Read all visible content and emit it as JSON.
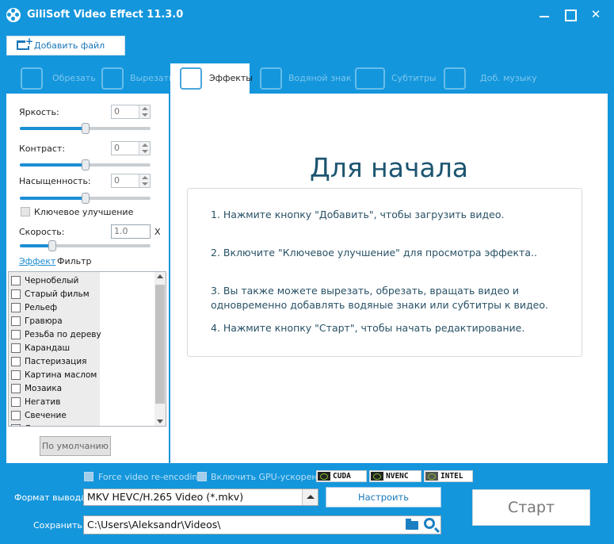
{
  "app": {
    "title": "GiliSoft Video Effect 11.3.0"
  },
  "toolbar": {
    "add_file_label": "Добавить файл"
  },
  "tabs": [
    {
      "label": "Обрезать",
      "icon": "crop-icon"
    },
    {
      "label": "Вырезать",
      "icon": "film-cut-icon"
    },
    {
      "label": "Эффекты",
      "icon": "magic-wand-icon",
      "active": true
    },
    {
      "label": "Водяной знак",
      "icon": "watermark-icon"
    },
    {
      "label": "Субтитры",
      "icon": "subtitle-icon"
    },
    {
      "label": "Доб. музыку",
      "icon": "music-note-icon"
    }
  ],
  "adjustments": {
    "brightness": {
      "label": "Яркость:",
      "value": "0",
      "level": 0.5
    },
    "contrast": {
      "label": "Контраст:",
      "value": "0",
      "level": 0.5
    },
    "saturation": {
      "label": "Насыщенность:",
      "value": "0",
      "level": 0.5
    },
    "key_enhance": {
      "label": "Ключевое улучшение",
      "checked": false
    },
    "speed": {
      "label": "Скорость:",
      "value": "1.0",
      "suffix": "X",
      "level": 0.25
    }
  },
  "effect_tabs": {
    "effect": "Эффект",
    "filter": "Фильтр"
  },
  "effects": [
    "Чернобелый",
    "Старый фильм",
    "Рельеф",
    "Гравюра",
    "Резьба по дереву",
    "Карандаш",
    "Пастеризация",
    "Картина маслом",
    "Мозаика",
    "Негатив",
    "Свечение",
    "Дымка"
  ],
  "reset_label": "По умолчанию",
  "main": {
    "heading": "Для начала",
    "instructions": [
      "1. Нажмите кнопку \"Добавить\", чтобы загрузить видео.",
      "2. Включите \"Ключевое улучшение\" для просмотра эффекта..",
      "3. Вы также можете вырезать, обрезать, вращать видео и одновременно добавлять водяные знаки или субтитры к видео.",
      "4. Нажмите кнопку \"Старт\", чтобы начать редактирование."
    ]
  },
  "bottom": {
    "force_reencode": "Force video re-encoding",
    "gpu_accel": "Включить GPU-ускорение",
    "gpu_badges": [
      "CUDA",
      "NVENC",
      "INTEL"
    ],
    "format_label": "Формат вывода:",
    "format_value": "MKV HEVC/H.265 Video (*.mkv)",
    "settings_label": "Настроить",
    "save_label": "Сохранить:",
    "save_path": "C:\\Users\\Aleksandr\\Videos\\",
    "start_label": "Старт"
  },
  "colors": {
    "accent": "#1496dc",
    "heading": "#1c5570",
    "instructions": "#285166"
  }
}
